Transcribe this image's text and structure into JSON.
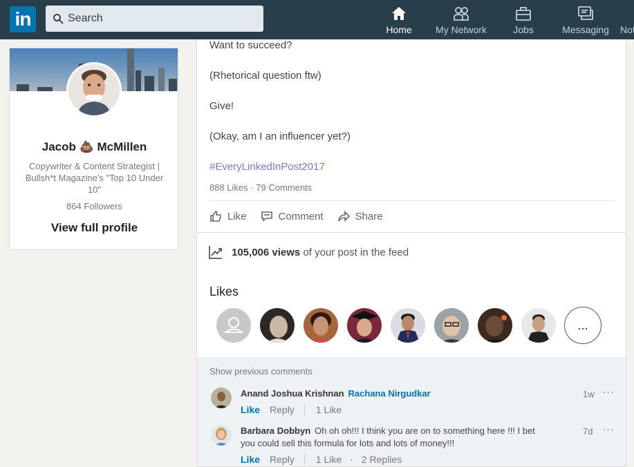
{
  "nav": {
    "logo": "in",
    "search_placeholder": "Search",
    "items": [
      {
        "label": "Home",
        "icon": "home-icon",
        "active": true
      },
      {
        "label": "My Network",
        "icon": "network-icon",
        "active": false
      },
      {
        "label": "Jobs",
        "icon": "briefcase-icon",
        "active": false
      },
      {
        "label": "Messaging",
        "icon": "messaging-icon",
        "active": false
      },
      {
        "label": "Not",
        "icon": "notifications-icon",
        "active": false
      }
    ]
  },
  "profile": {
    "name": "Jacob 💩 McMillen",
    "headline": "Copywriter & Content Strategist | Bullsh*t Magazine's \"Top 10 Under 10\"",
    "followers": "864 Followers",
    "link": "View full profile"
  },
  "post": {
    "lines": [
      "Want to succeed?",
      "(Rhetorical question ftw)",
      "Give!",
      "(Okay, am I an influencer yet?)"
    ],
    "hashtag": "#EveryLinkedInPost2017",
    "likes_count": "888 Likes",
    "comments_count": "79 Comments",
    "stats_sep": "·",
    "actions": {
      "like": "Like",
      "comment": "Comment",
      "share": "Share"
    },
    "views_number": "105,006 views",
    "views_rest": "of your post in the feed",
    "likes_title": "Likes",
    "more_likers": "..."
  },
  "comments": {
    "show_previous": "Show previous comments",
    "items": [
      {
        "author": "Anand Joshua Krishnan",
        "mention": "Rachana Nirgudkar",
        "text": "",
        "time": "1w",
        "menu": "···",
        "like": "Like",
        "reply": "Reply",
        "likes": "1 Like",
        "replies": ""
      },
      {
        "author": "Barbara Dobbyn",
        "mention": "",
        "text": "Oh oh oh!!! I think you are on to something here !!! I bet you could sell this formula for lots and lots of money!!!",
        "time": "7d",
        "menu": "···",
        "like": "Like",
        "reply": "Reply",
        "likes": "1 Like",
        "sep": "·",
        "replies": "2 Replies"
      }
    ]
  },
  "colors": {
    "nav_bg": "#283e4a",
    "brand": "#0073b1",
    "hashtag": "#8a6fd8",
    "comments_bg": "#eef2f5"
  }
}
